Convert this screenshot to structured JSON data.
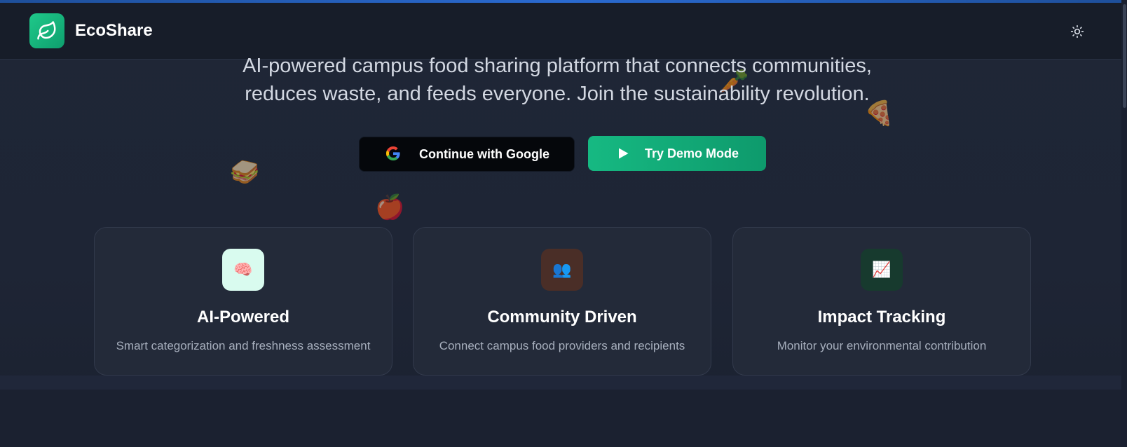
{
  "header": {
    "brand": "EcoShare",
    "logo_icon": "leaf-icon",
    "theme_toggle_icon": "sun-icon"
  },
  "hero": {
    "tagline_line1": "AI-powered campus food sharing platform that connects communities,",
    "tagline_line2": "reduces waste, and feeds everyone. Join the sustainability revolution."
  },
  "actions": {
    "google_label": "Continue with Google",
    "google_icon": "google-icon",
    "demo_label": "Try Demo Mode",
    "demo_icon": "play-icon"
  },
  "features": [
    {
      "title": "AI-Powered",
      "description": "Smart categorization and freshness assessment",
      "icon": "brain-icon",
      "emoji": "🧠",
      "icon_bg": "#d9fbef"
    },
    {
      "title": "Community Driven",
      "description": "Connect campus food providers and recipients",
      "icon": "people-icon",
      "emoji": "👥",
      "icon_bg": "#4a2e27"
    },
    {
      "title": "Impact Tracking",
      "description": "Monitor your environmental contribution",
      "icon": "chart-increasing-icon",
      "emoji": "📈",
      "icon_bg": "#173a2e"
    }
  ],
  "decorations": [
    {
      "icon": "sandwich-icon",
      "emoji": "🥪"
    },
    {
      "icon": "apple-icon",
      "emoji": "🍎"
    },
    {
      "icon": "carrot-icon",
      "emoji": "🥕"
    },
    {
      "icon": "pizza-icon",
      "emoji": "🍕"
    }
  ],
  "colors": {
    "accent": "#10b981",
    "background": "#1e2535",
    "header_bg": "#171d29",
    "card_bg": "#232a39"
  }
}
